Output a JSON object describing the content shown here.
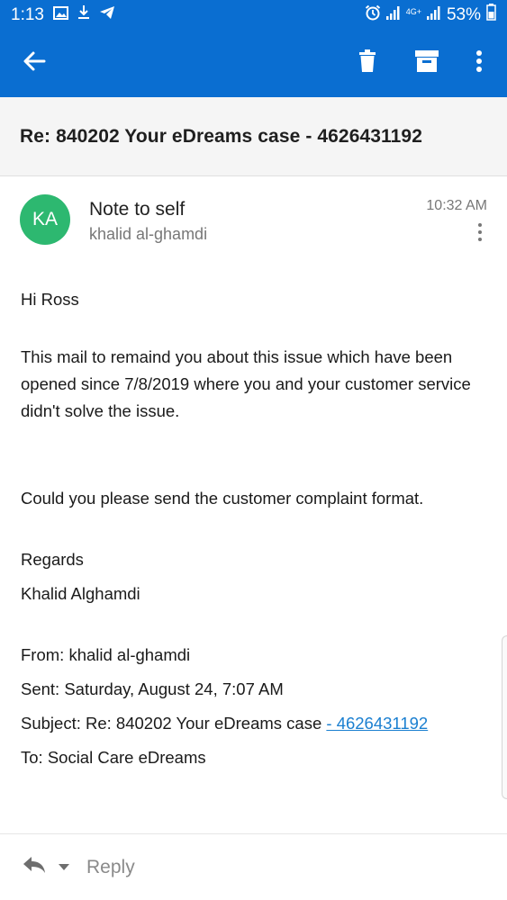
{
  "status_bar": {
    "time": "1:13",
    "network": "4G+",
    "battery": "53%",
    "icons": [
      "image-icon",
      "download-icon",
      "telegram-icon",
      "alarm-icon",
      "signal-icon",
      "signal-icon",
      "battery-icon"
    ]
  },
  "app_bar": {
    "icons": [
      "back-arrow-icon",
      "delete-icon",
      "archive-icon",
      "more-vert-icon"
    ]
  },
  "email": {
    "subject": "Re: 840202 Your eDreams case - 4626431192",
    "avatar_initials": "KA",
    "avatar_color": "#2db870",
    "sender_name": "Note to self",
    "sender_sub": "khalid al-ghamdi",
    "time": "10:32 AM",
    "greeting": "Hi Ross",
    "paragraph1": "This mail to remaind you about this issue which have been opened since 7/8/2019 where you and your customer service didn't solve the issue.",
    "paragraph2": "Could you please send the customer complaint format.",
    "regards": "Regards",
    "signature": "Khalid Alghamdi",
    "from_line": "From: khalid al-ghamdi",
    "sent_line": "Sent: Saturday, August 24, 7:07 AM",
    "subject_line_prefix": "Subject: Re: 840202 Your eDreams case ",
    "subject_line_link": "- 4626431192",
    "to_line": "To: Social Care eDreams"
  },
  "reply_bar": {
    "label": "Reply"
  },
  "colors": {
    "primary": "#0a6ed1",
    "link": "#1a7fd0"
  }
}
